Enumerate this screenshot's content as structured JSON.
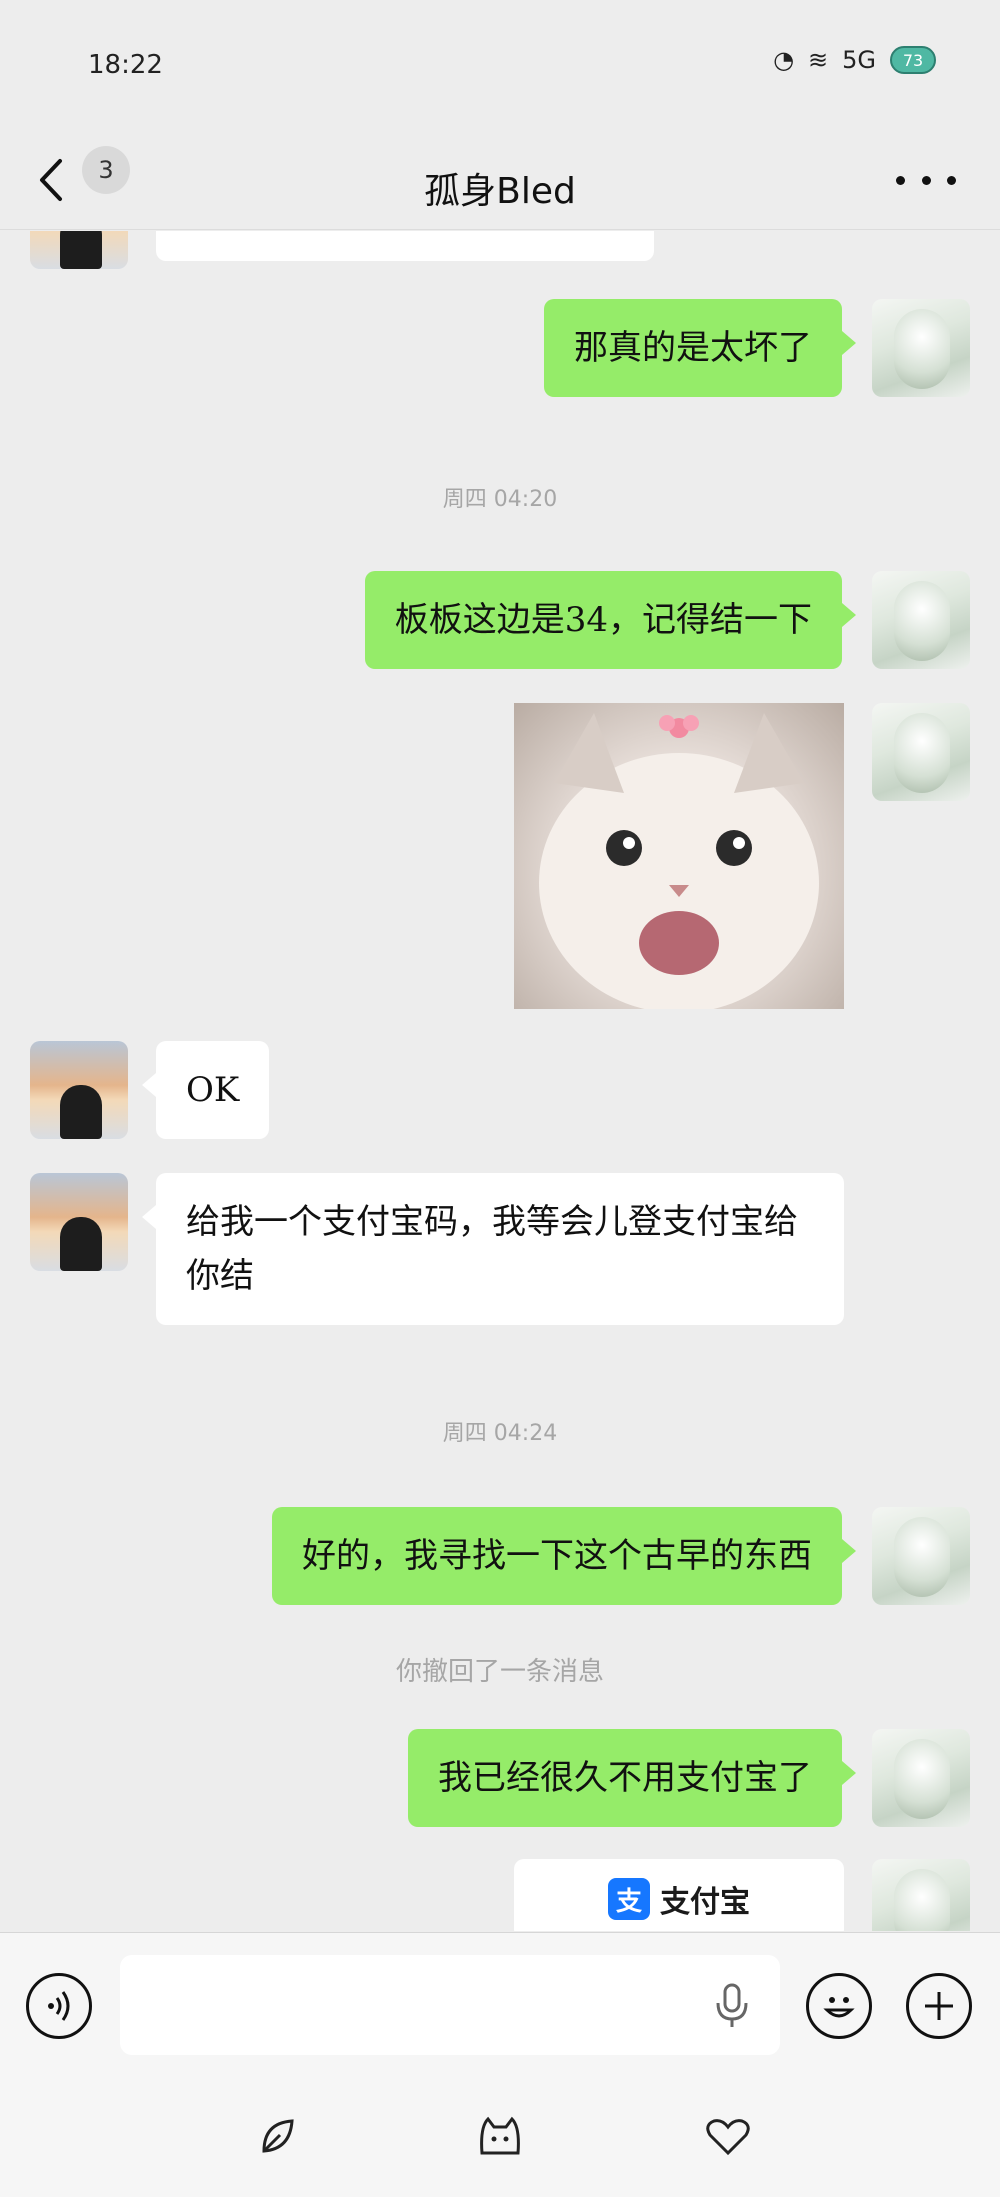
{
  "status_bar": {
    "time": "18:22",
    "network": "5G",
    "battery": "73"
  },
  "header": {
    "unread_count": "3",
    "title": "孤身Bled"
  },
  "messages": {
    "m1_text": "那真的是太坏了",
    "ts1": "周四 04:20",
    "m2_text": "板板这边是34，记得结一下",
    "m4_text": "OK",
    "m5_text": "给我一个支付宝码，我等会儿登支付宝给你结",
    "ts2": "周四 04:24",
    "m6_text": "好的，我寻找一下这个古早的东西",
    "recall_note": "你撤回了一条消息",
    "m7_text": "我已经很久不用支付宝了",
    "card_logo": "支",
    "card_name": "支付宝"
  },
  "input": {
    "placeholder": ""
  },
  "colors": {
    "self_bubble": "#95ec69",
    "friend_bubble": "#ffffff",
    "background": "#ededed"
  },
  "icons": [
    "back-icon",
    "more-icon",
    "voice-icon",
    "mic-icon",
    "emoji-icon",
    "plus-icon",
    "leaf-nav-icon",
    "cat-nav-icon",
    "heart-nav-icon"
  ]
}
